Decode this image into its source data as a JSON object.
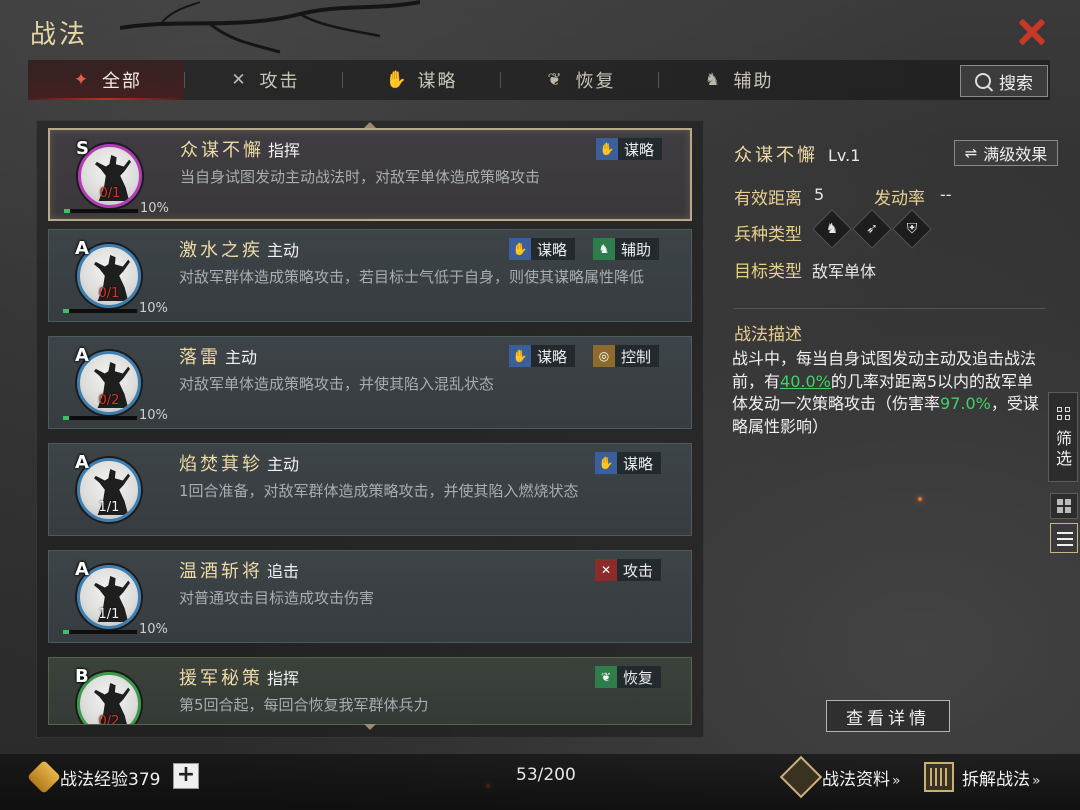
{
  "header": {
    "title": "战法"
  },
  "tabs": [
    {
      "label": "全部",
      "icon": "all-icon",
      "active": true
    },
    {
      "label": "攻击",
      "icon": "crossed-swords-icon",
      "active": false
    },
    {
      "label": "谋略",
      "icon": "strategy-hand-icon",
      "active": false
    },
    {
      "label": "恢复",
      "icon": "recover-icon",
      "active": false
    },
    {
      "label": "辅助",
      "icon": "assist-icon",
      "active": false
    }
  ],
  "search": {
    "label": "搜索"
  },
  "tactics": [
    {
      "grade": "S",
      "count": "0/1",
      "count_red": true,
      "xp": "10%",
      "name": "众谋不懈",
      "kind": "指挥",
      "desc": "当自身试图发动主动战法时，对敌军单体造成策略攻击",
      "badges": [
        "谋略"
      ],
      "selected": true
    },
    {
      "grade": "A",
      "count": "0/1",
      "count_red": true,
      "xp": "10%",
      "name": "激水之疾",
      "kind": "主动",
      "desc": "对敌军群体造成策略攻击，若目标士气低于自身，则使其谋略属性降低",
      "badges": [
        "谋略",
        "辅助"
      ]
    },
    {
      "grade": "A",
      "count": "0/2",
      "count_red": true,
      "xp": "10%",
      "name": "落雷",
      "kind": "主动",
      "desc": "对敌军单体造成策略攻击，并使其陷入混乱状态",
      "badges": [
        "谋略",
        "控制"
      ]
    },
    {
      "grade": "A",
      "count": "1/1",
      "count_red": false,
      "xp": "",
      "name": "焰焚萁轸",
      "kind": "主动",
      "desc": "1回合准备，对敌军群体造成策略攻击，并使其陷入燃烧状态",
      "badges": [
        "谋略"
      ]
    },
    {
      "grade": "A",
      "count": "1/1",
      "count_red": false,
      "xp": "10%",
      "name": "温酒斩将",
      "kind": "追击",
      "desc": "对普通攻击目标造成攻击伤害",
      "badges": [
        "攻击"
      ]
    },
    {
      "grade": "B",
      "count": "0/2",
      "count_red": true,
      "xp": "",
      "name": "援军秘策",
      "kind": "指挥",
      "desc": "第5回合起，每回合恢复我军群体兵力",
      "badges": [
        "恢复"
      ]
    }
  ],
  "detail": {
    "name": "众谋不懈",
    "level": "Lv.1",
    "max_level_btn": "满级效果",
    "range_label": "有效距离",
    "range_value": "5",
    "rate_label": "发动率",
    "rate_value": "--",
    "unit_label": "兵种类型",
    "unit_icons": [
      "cavalry-icon",
      "archer-icon",
      "shield-icon"
    ],
    "target_label": "目标类型",
    "target_value": "敌军单体",
    "desc_title": "战法描述",
    "desc_p1": "战斗中，每当自身试图发动主动及追击战法前，有",
    "desc_pct1": "40.0%",
    "desc_p2": "的几率对距离5以内的敌军单体发动一次策略攻击（伤害率",
    "desc_pct2": "97.0%",
    "desc_p3": "，受谋略属性影响）",
    "view_btn": "查看详情"
  },
  "side": {
    "filter_label": "筛选"
  },
  "footer": {
    "xp_label": "战法经验379",
    "plus": "+",
    "count": "53/200",
    "info_link": "战法资料",
    "disassemble_link": "拆解战法",
    "chevron": "»"
  },
  "colors": {
    "accent_red": "#c9392a",
    "gold": "#e6cf8e",
    "green_highlight": "#3fd266"
  }
}
